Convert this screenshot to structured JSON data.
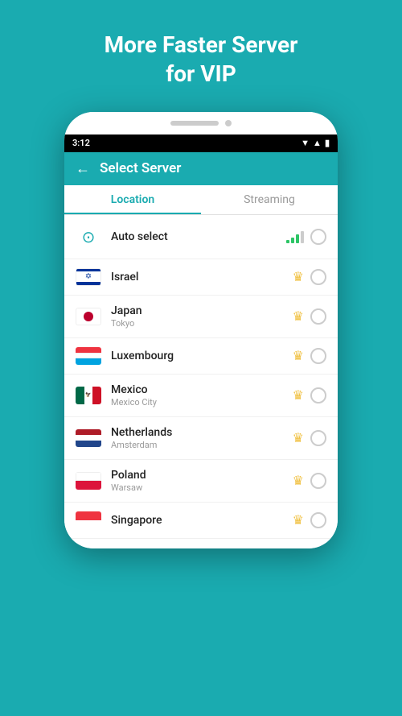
{
  "hero": {
    "line1": "More Faster Server",
    "line2": "for VIP"
  },
  "statusBar": {
    "time": "3:12",
    "icons": "▼▲▲"
  },
  "appBar": {
    "backIcon": "←",
    "title": "Select Server"
  },
  "tabs": [
    {
      "id": "location",
      "label": "Location",
      "active": true
    },
    {
      "id": "streaming",
      "label": "Streaming",
      "active": false
    }
  ],
  "servers": [
    {
      "id": "auto",
      "name": "Auto select",
      "city": "",
      "type": "auto",
      "vip": false
    },
    {
      "id": "israel",
      "name": "Israel",
      "city": "",
      "type": "flag-il",
      "vip": true
    },
    {
      "id": "japan",
      "name": "Japan",
      "city": "Tokyo",
      "type": "flag-jp",
      "vip": true
    },
    {
      "id": "luxembourg",
      "name": "Luxembourg",
      "city": "",
      "type": "flag-lu",
      "vip": true
    },
    {
      "id": "mexico",
      "name": "Mexico",
      "city": "Mexico City",
      "type": "flag-mx",
      "vip": true
    },
    {
      "id": "netherlands",
      "name": "Netherlands",
      "city": "Amsterdam",
      "type": "flag-nl",
      "vip": true
    },
    {
      "id": "poland",
      "name": "Poland",
      "city": "Warsaw",
      "type": "flag-pl",
      "vip": true
    },
    {
      "id": "singapore",
      "name": "Singapore",
      "city": "",
      "type": "flag-sg",
      "vip": true
    }
  ],
  "colors": {
    "teal": "#1aabb0",
    "activeTab": "#1aabb0",
    "inactiveTab": "#999999",
    "crown": "#f0c040"
  }
}
